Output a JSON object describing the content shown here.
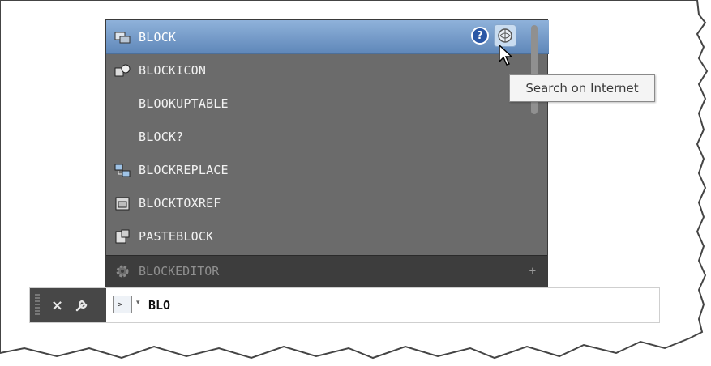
{
  "autocomplete": {
    "items": [
      {
        "label": "BLOCK",
        "icon": "block-icon",
        "selected": true
      },
      {
        "label": "BLOCKICON",
        "icon": "block-icon-generator-icon",
        "selected": false
      },
      {
        "label": "BLOOKUPTABLE",
        "icon": "",
        "selected": false
      },
      {
        "label": "BLOCK?",
        "icon": "",
        "selected": false
      },
      {
        "label": "BLOCKREPLACE",
        "icon": "block-replace-icon",
        "selected": false
      },
      {
        "label": "BLOCKTOXREF",
        "icon": "block-to-xref-icon",
        "selected": false
      },
      {
        "label": "PASTEBLOCK",
        "icon": "paste-block-icon",
        "selected": false
      }
    ],
    "footer": {
      "label": "BLOCKEDITOR",
      "icon": "gear-icon",
      "expand": "+"
    },
    "help_label": "?",
    "tooltip": "Search on Internet"
  },
  "command_line": {
    "close_label": "×",
    "prompt_icon": ">_",
    "caret": "▾",
    "input_value": "BLO"
  },
  "colors": {
    "panel_bg": "#6b6b6b",
    "selected_bg": "#7da1cc",
    "footer_bg": "#3d3d3d",
    "cmd_left_bg": "#474747"
  }
}
